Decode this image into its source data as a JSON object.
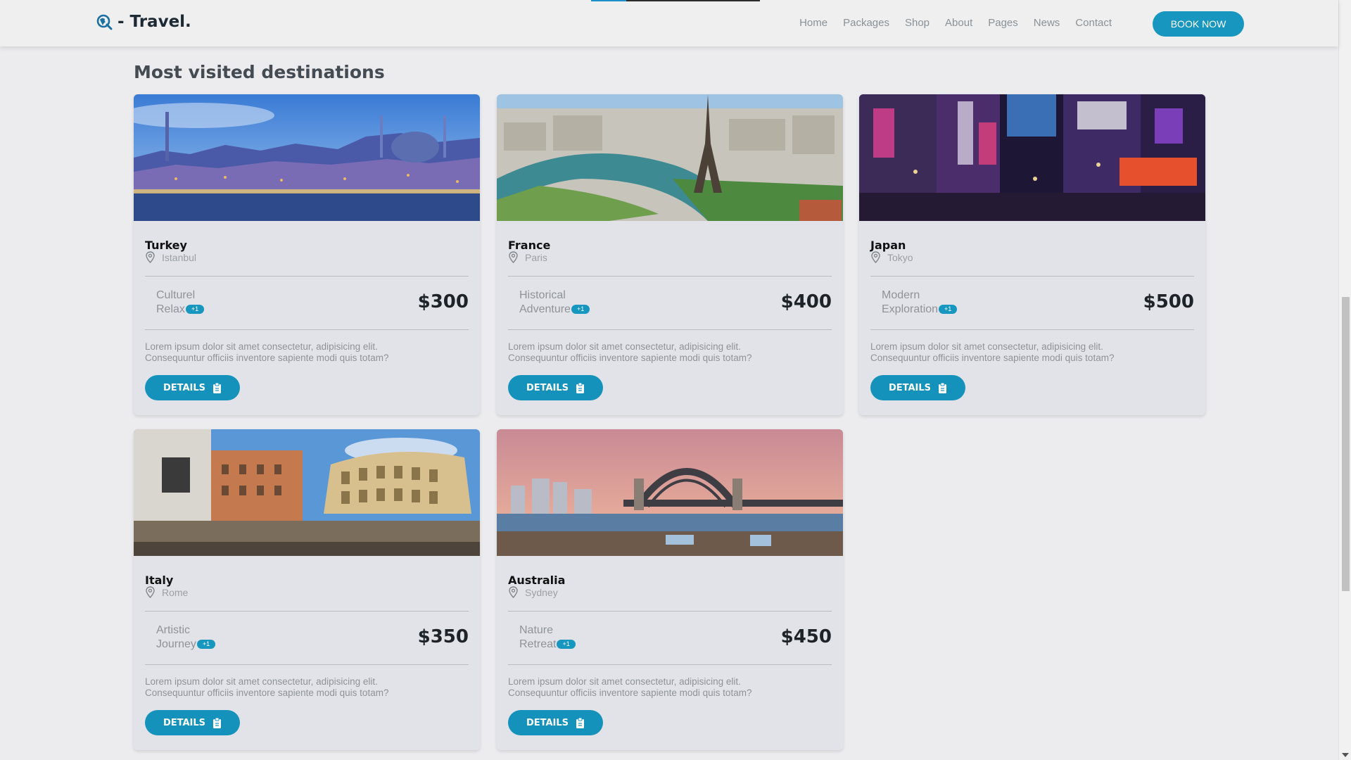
{
  "header": {
    "logo_text": "- Travel.",
    "nav": [
      "Home",
      "Packages",
      "Shop",
      "About",
      "Pages",
      "News",
      "Contact"
    ],
    "book_label": "BOOK NOW"
  },
  "section": {
    "title": "Most visited destinations"
  },
  "cards": [
    {
      "country": "Turkey",
      "city": "Istanbul",
      "tag_line1": "Culturel",
      "tag_line2": "Relax",
      "badge": "+1",
      "price": "$300",
      "desc_line1": "Lorem ipsum dolor sit amet consectetur, adipisicing elit.",
      "desc_line2": "Consequuntur officiis inventore sapiente modi quis totam?",
      "button": "DETAILS"
    },
    {
      "country": "France",
      "city": "Paris",
      "tag_line1": "Historical",
      "tag_line2": "Adventure",
      "badge": "+1",
      "price": "$400",
      "desc_line1": "Lorem ipsum dolor sit amet consectetur, adipisicing elit.",
      "desc_line2": "Consequuntur officiis inventore sapiente modi quis totam?",
      "button": "DETAILS"
    },
    {
      "country": "Japan",
      "city": "Tokyo",
      "tag_line1": "Modern",
      "tag_line2": "Exploration",
      "badge": "+1",
      "price": "$500",
      "desc_line1": "Lorem ipsum dolor sit amet consectetur, adipisicing elit.",
      "desc_line2": "Consequuntur officiis inventore sapiente modi quis totam?",
      "button": "DETAILS"
    },
    {
      "country": "Italy",
      "city": "Rome",
      "tag_line1": "Artistic",
      "tag_line2": "Journey",
      "badge": "+1",
      "price": "$350",
      "desc_line1": "Lorem ipsum dolor sit amet consectetur, adipisicing elit.",
      "desc_line2": "Consequuntur officiis inventore sapiente modi quis totam?",
      "button": "DETAILS"
    },
    {
      "country": "Australia",
      "city": "Sydney",
      "tag_line1": "Nature",
      "tag_line2": "Retreat",
      "badge": "+1",
      "price": "$450",
      "desc_line1": "Lorem ipsum dolor sit amet consectetur, adipisicing elit.",
      "desc_line2": "Consequuntur officiis inventore sapiente modi quis totam?",
      "button": "DETAILS"
    }
  ],
  "colors": {
    "accent": "#1796bf",
    "background": "#ececef",
    "card": "#e2e3e8"
  },
  "icons": [
    "search-globe-icon",
    "location-pin-icon",
    "clipboard-icon"
  ]
}
